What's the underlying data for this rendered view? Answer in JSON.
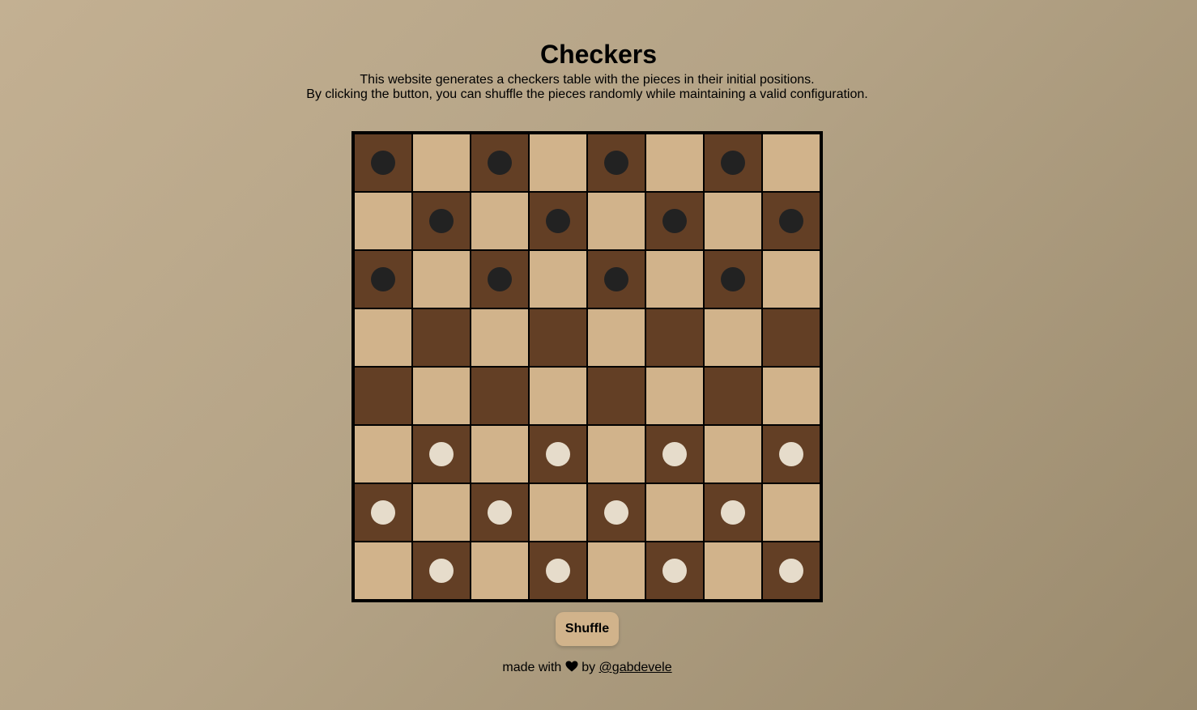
{
  "header": {
    "title": "Checkers",
    "description_line1": "This website generates a checkers table with the pieces in their initial positions.",
    "description_line2": "By clicking the button, you can shuffle the pieces randomly while maintaining a valid configuration."
  },
  "board": {
    "size": 8,
    "dark_color": "#633f25",
    "light_color": "#d1b38b",
    "black_piece_color": "#222222",
    "white_piece_color": "#e6dccb",
    "rows": [
      [
        "b",
        "",
        "b",
        "",
        "b",
        "",
        "b",
        ""
      ],
      [
        "",
        "b",
        "",
        "b",
        "",
        "b",
        "",
        "b"
      ],
      [
        "b",
        "",
        "b",
        "",
        "b",
        "",
        "b",
        ""
      ],
      [
        "",
        "",
        "",
        "",
        "",
        "",
        "",
        ""
      ],
      [
        "",
        "",
        "",
        "",
        "",
        "",
        "",
        ""
      ],
      [
        "",
        "w",
        "",
        "w",
        "",
        "w",
        "",
        "w"
      ],
      [
        "w",
        "",
        "w",
        "",
        "w",
        "",
        "w",
        ""
      ],
      [
        "",
        "w",
        "",
        "w",
        "",
        "w",
        "",
        "w"
      ]
    ]
  },
  "controls": {
    "shuffle_label": "Shuffle"
  },
  "footer": {
    "made_with": "made with",
    "heart_icon": "heart-icon",
    "by": "by",
    "author_link": "@gabdevele"
  }
}
